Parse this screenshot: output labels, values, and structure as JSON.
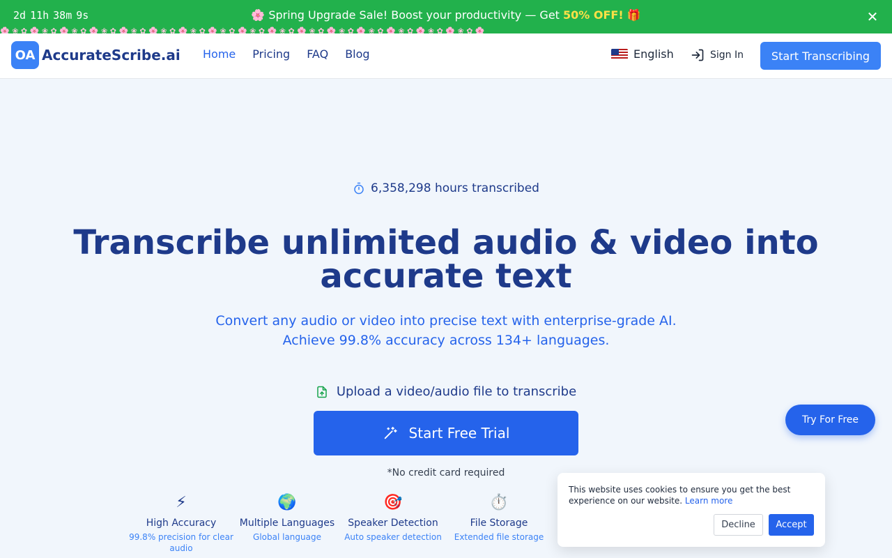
{
  "promo": {
    "countdown": {
      "days": "2d",
      "hours": "11h",
      "minutes": "38m",
      "seconds": "9s"
    },
    "emoji_left": "🌸",
    "text": "Spring Upgrade Sale! Boost your productivity — Get",
    "highlight": "50% OFF!",
    "emoji_right": "🎁",
    "close_icon": "✕",
    "colors": {
      "background": "#22b14c",
      "highlight": "#fde047"
    }
  },
  "header": {
    "logo_mark": "OA",
    "logo_text": "AccurateScribe.ai",
    "nav": [
      {
        "label": "Home"
      },
      {
        "label": "Pricing"
      },
      {
        "label": "FAQ"
      },
      {
        "label": "Blog"
      }
    ],
    "language": "English",
    "sign_in": "Sign In",
    "cta": "Start Transcribing"
  },
  "hero": {
    "stat": "6,358,298 hours transcribed",
    "headline": "Transcribe unlimited audio & video into accurate text",
    "subhead_line1": "Convert any audio or video into precise text with enterprise-grade AI.",
    "subhead_line2": "Achieve 99.8% accuracy across 134+ languages.",
    "upload_label": "Upload a video/audio file to transcribe",
    "trial_button": "Start Free Trial",
    "no_credit_card": "*No credit card required"
  },
  "features": [
    {
      "icon": "⚡",
      "title": "High Accuracy",
      "desc": "99.8% precision for clear audio"
    },
    {
      "icon": "🌍",
      "title": "Multiple Languages",
      "desc": "Global language"
    },
    {
      "icon": "🎯",
      "title": "Speaker Detection",
      "desc": "Auto speaker detection"
    },
    {
      "icon": "⏱️",
      "title": "File Storage",
      "desc": "Extended file storage"
    }
  ],
  "floating_cta": "Try For Free",
  "cookie": {
    "text": "This website uses cookies to ensure you get the best experience on our website.",
    "learn_more": "Learn more",
    "decline": "Decline",
    "accept": "Accept"
  },
  "colors": {
    "primary": "#2563eb",
    "accent": "#3b82f6",
    "heading": "#1e3a8a"
  }
}
